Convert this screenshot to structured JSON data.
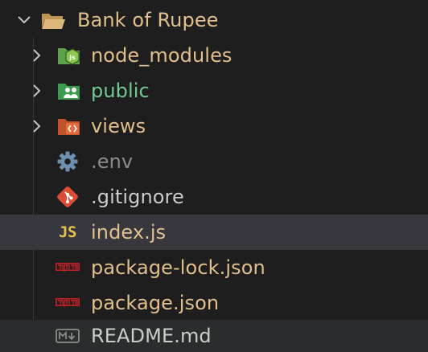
{
  "colors": {
    "background": "#1e1e1e",
    "selected_row": "#37373d",
    "hover_row": "#2a2d2e",
    "default_text": "#cccccc",
    "modified_text": "#e2c08d",
    "added_text": "#73c991",
    "ignored_text": "#8c8c8c"
  },
  "explorer": {
    "root": {
      "label": "Bank of Rupee",
      "icon": "folder-open-icon",
      "expanded": true
    },
    "items": [
      {
        "label": "node_modules",
        "icon": "folder-node-icon",
        "type": "folder",
        "expanded": false
      },
      {
        "label": "public",
        "icon": "folder-public-icon",
        "type": "folder",
        "expanded": false
      },
      {
        "label": "views",
        "icon": "folder-views-icon",
        "type": "folder",
        "expanded": false
      },
      {
        "label": ".env",
        "icon": "gear-icon",
        "type": "file"
      },
      {
        "label": ".gitignore",
        "icon": "git-icon",
        "type": "file"
      },
      {
        "label": "index.js",
        "icon": "javascript-icon",
        "icon_text": "JS",
        "type": "file",
        "selected": true
      },
      {
        "label": "package-lock.json",
        "icon": "npm-icon",
        "type": "file"
      },
      {
        "label": "package.json",
        "icon": "npm-icon",
        "type": "file"
      },
      {
        "label": "README.md",
        "icon": "markdown-icon",
        "type": "file",
        "hovered": true
      }
    ]
  }
}
